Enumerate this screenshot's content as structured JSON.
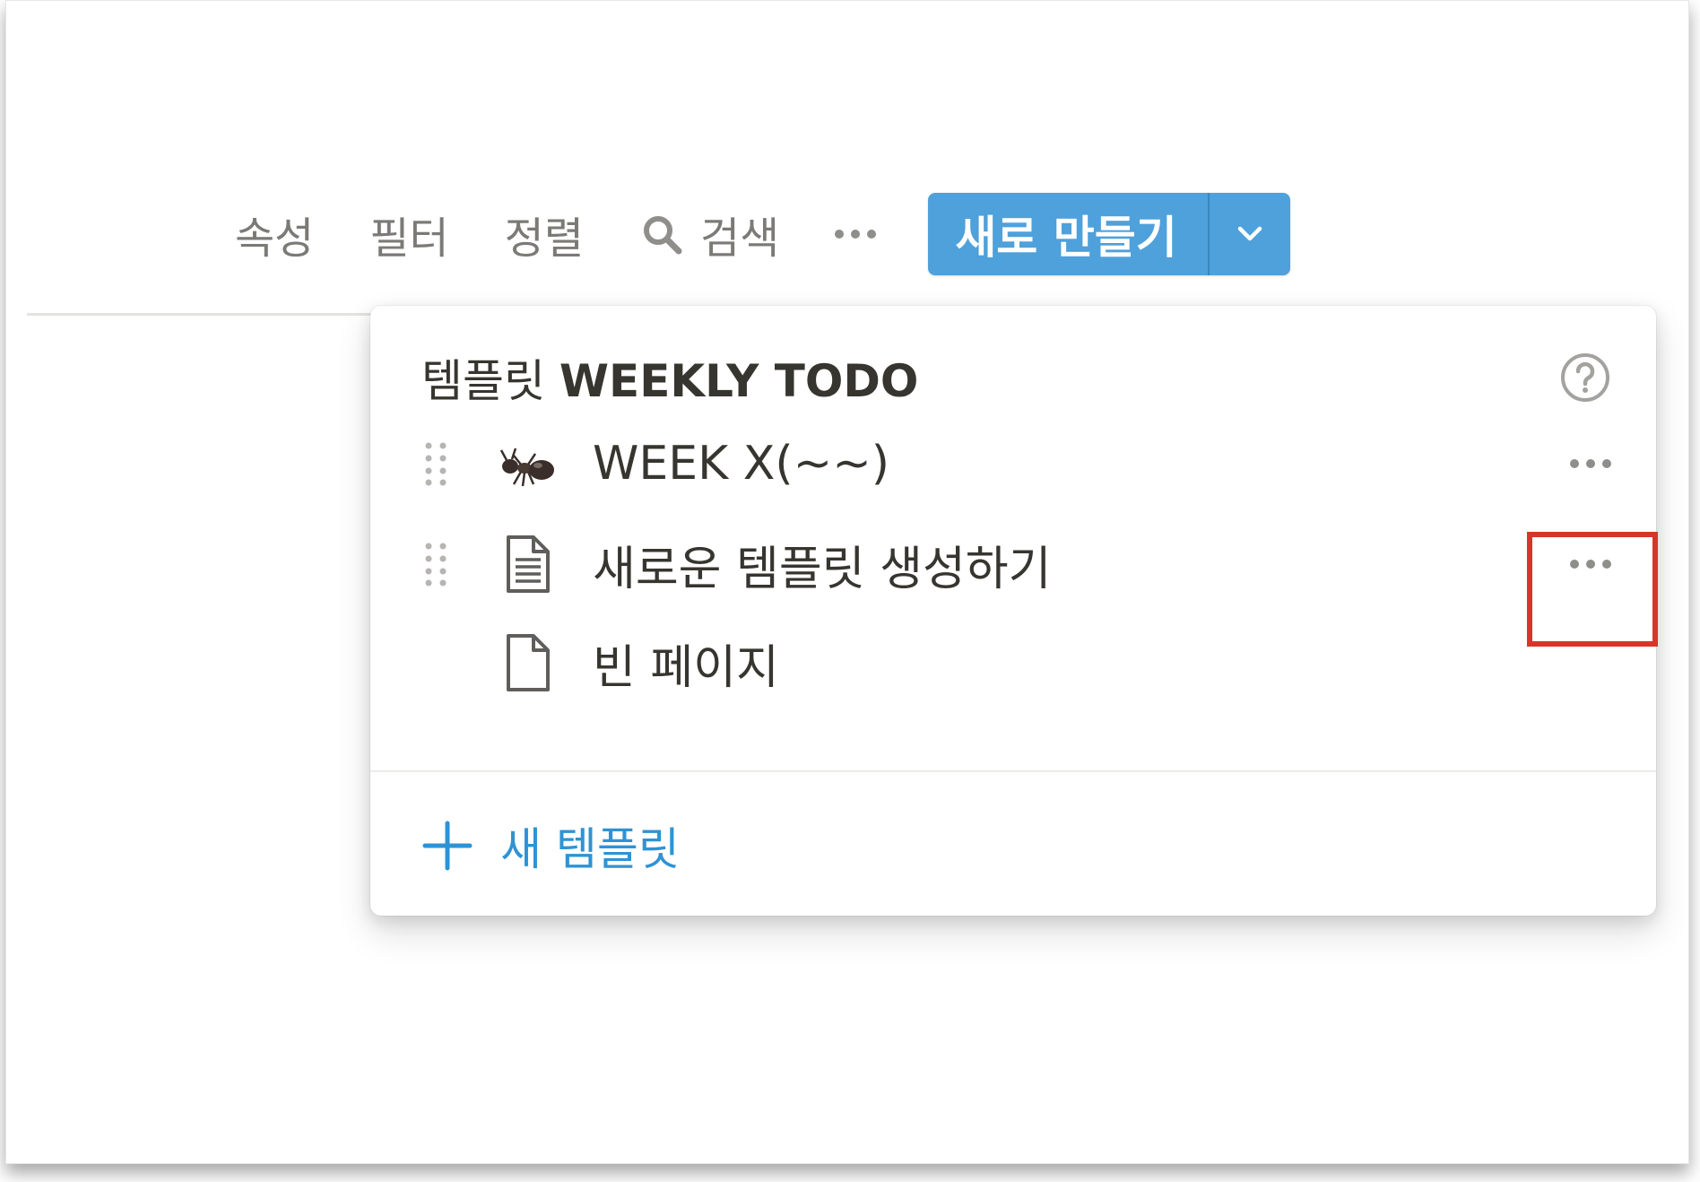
{
  "toolbar": {
    "properties_label": "속성",
    "filter_label": "필터",
    "sort_label": "정렬",
    "search_label": "검색",
    "more_icon": "ellipsis-icon",
    "new_button_label": "새로 만들기",
    "new_button_dropdown_icon": "chevron-down-icon"
  },
  "template_menu": {
    "title_prefix": "템플릿",
    "title_name": "WEEKLY TODO",
    "help_icon": "question-circle-icon",
    "items": [
      {
        "icon": "ant-emoji",
        "emoji": "🐜",
        "label": "WEEK X(~~)",
        "has_handle": true,
        "has_more": true
      },
      {
        "icon": "document-lines-icon",
        "label": "새로운 템플릿 생성하기",
        "has_handle": true,
        "has_more": true
      },
      {
        "icon": "blank-page-icon",
        "label": "빈 페이지",
        "has_handle": false,
        "has_more": false
      }
    ],
    "new_template_label": "새 템플릿"
  },
  "colors": {
    "accent_blue": "#4ea1db",
    "link_blue": "#2e93d4",
    "highlight_red": "#d8352a",
    "text_gray": "#7b7a76"
  }
}
